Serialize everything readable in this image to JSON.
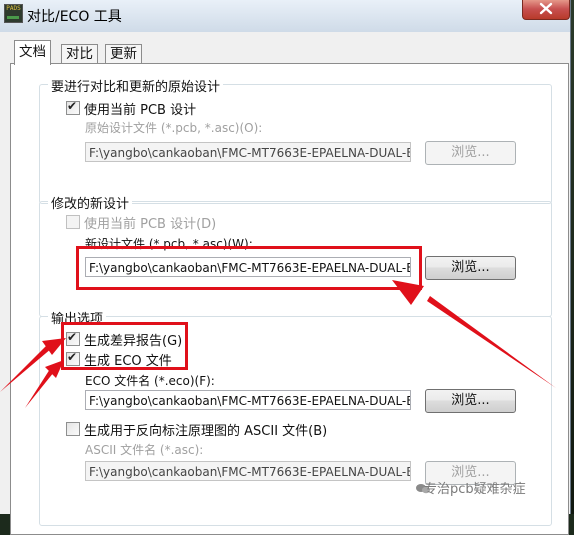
{
  "window": {
    "title": "对比/ECO 工具",
    "app_icon_text": "PADS"
  },
  "tabs": [
    {
      "label": "文档"
    },
    {
      "label": "对比"
    },
    {
      "label": "更新"
    }
  ],
  "original_group": {
    "title": "要进行对比和更新的原始设计",
    "use_current_label": "使用当前 PCB 设计",
    "file_label": "原始设计文件 (*.pcb, *.asc)(O):",
    "file_value": "F:\\yangbo\\cankaoban\\FMC-MT7663E-EPAELNA-DUAL-E",
    "browse_label": "浏览..."
  },
  "modified_group": {
    "title": "修改的新设计",
    "use_current_label": "使用当前 PCB 设计(D)",
    "file_label": "新设计文件 (*.pcb, *.asc)(W):",
    "file_value": "F:\\yangbo\\cankaoban\\FMC-MT7663E-EPAELNA-DUAL-E",
    "browse_label": "浏览..."
  },
  "output_group": {
    "title": "输出选项",
    "diff_report_label": "生成差异报告(G)",
    "eco_file_label": "生成 ECO 文件",
    "eco_name_label": "ECO 文件名 (*.eco)(F):",
    "eco_value": "F:\\yangbo\\cankaoban\\FMC-MT7663E-EPAELNA-DUAL-E",
    "browse_label": "浏览...",
    "ascii_label": "生成用于反向标注原理图的 ASCII 文件(B)",
    "ascii_name_label": "ASCII 文件名 (*.asc):",
    "ascii_value": "F:\\yangbo\\cankaoban\\FMC-MT7663E-EPAELNA-DUAL-E",
    "ascii_browse_label": "浏览..."
  },
  "watermark": {
    "text": "专治pcb疑难杂症"
  },
  "colors": {
    "highlight": "#e0101a",
    "titlebar": "#dbe6f1",
    "close": "#c75050"
  }
}
